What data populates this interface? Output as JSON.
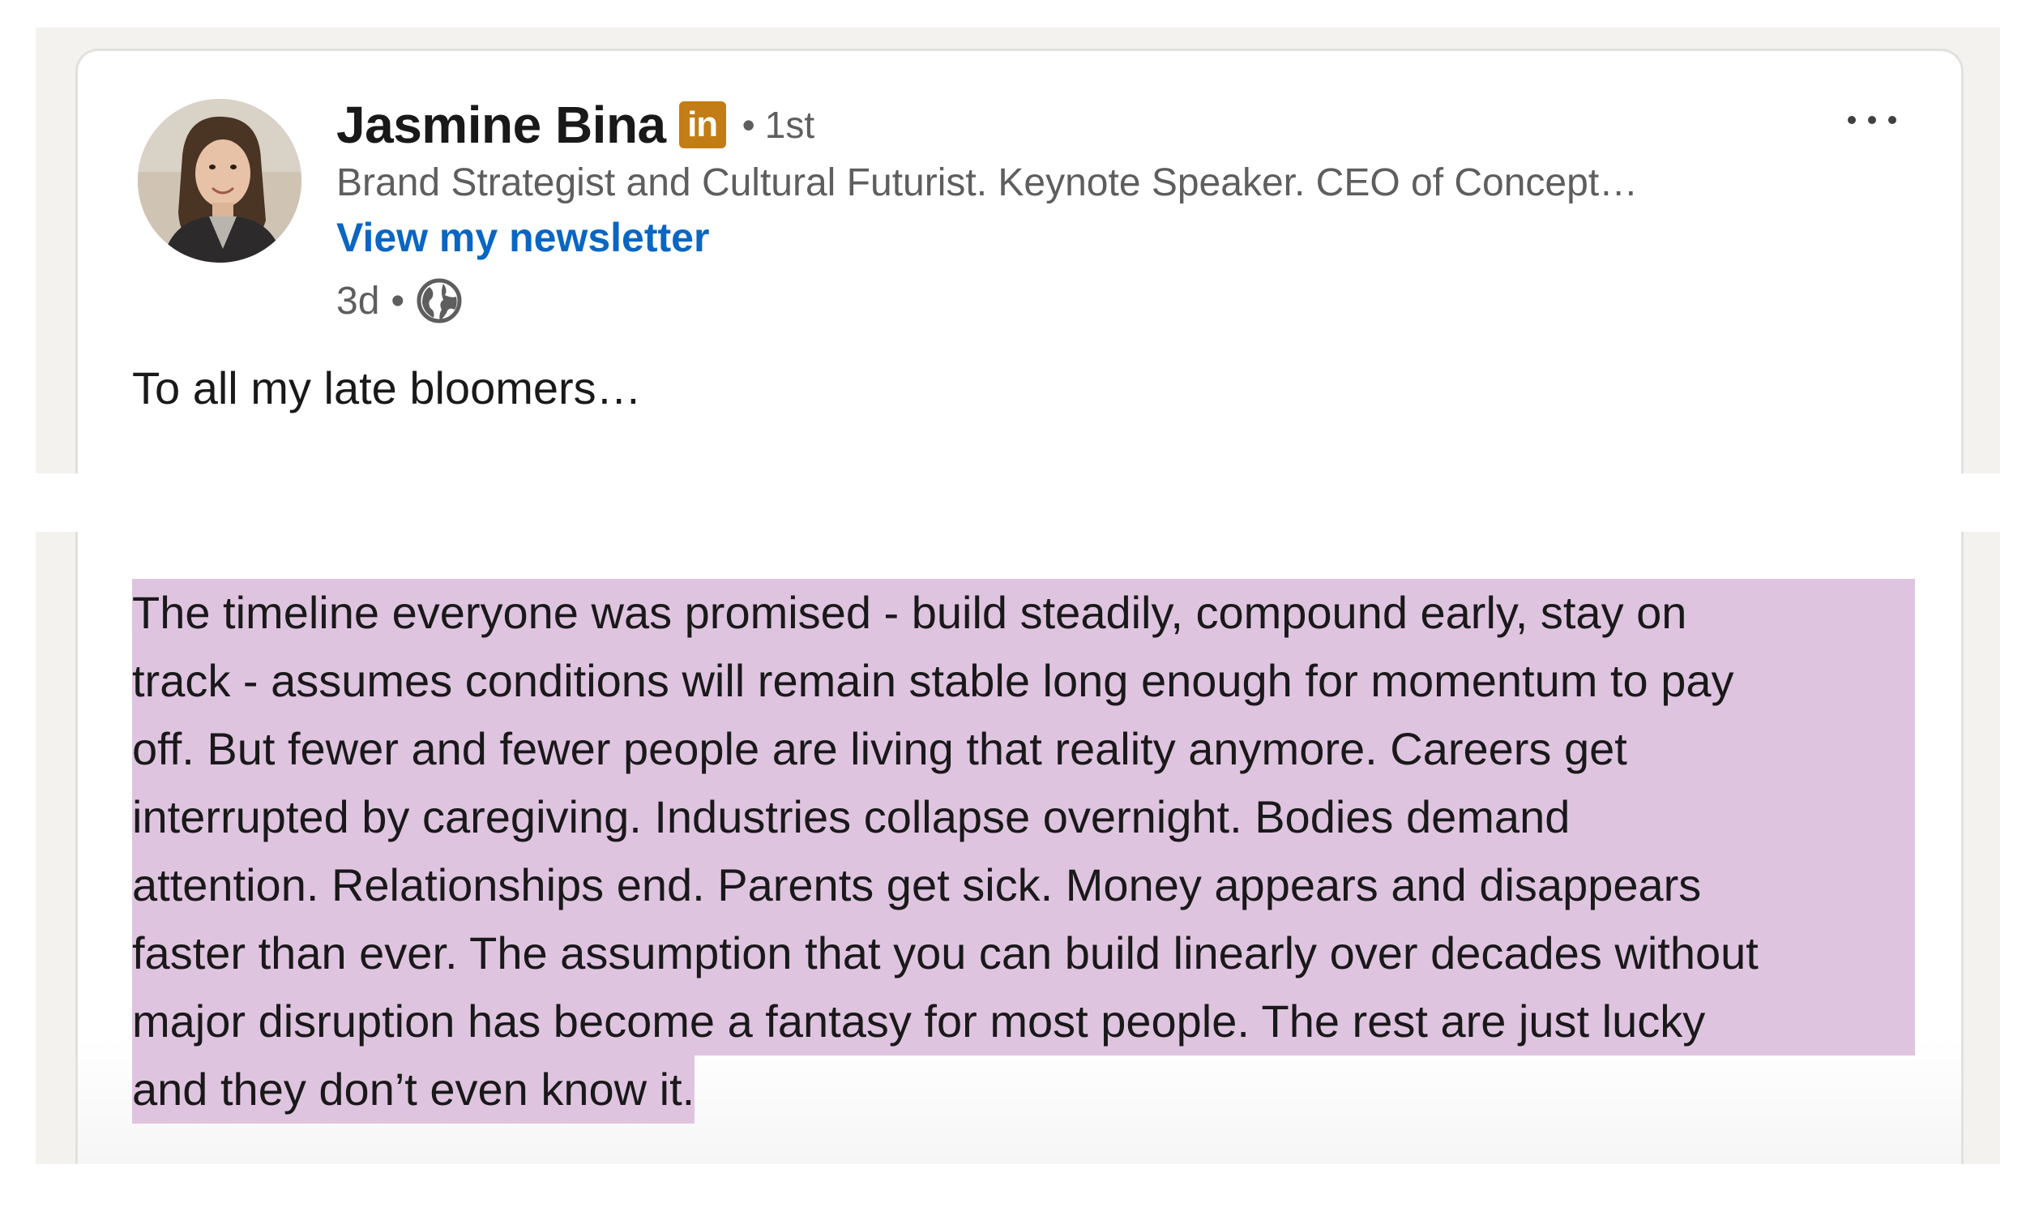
{
  "post": {
    "author": {
      "name": "Jasmine Bina",
      "badge_text": "in",
      "degree": "1st",
      "degree_separator": "•",
      "headline": "Brand Strategist and Cultural Futurist. Keynote Speaker. CEO of Concept…",
      "newsletter_link": "View my newsletter",
      "time_ago": "3d",
      "time_separator": "•",
      "visibility_icon": "globe-icon"
    },
    "more_icon": "more-horizontal-icon",
    "intro_text": "To all my late bloomers…",
    "body_lines": [
      "The timeline everyone was promised - build steadily, compound early, stay on",
      "track - assumes conditions will remain stable long enough for momentum to pay",
      "off. But fewer and fewer people are living that reality anymore. Careers get",
      "interrupted by caregiving. Industries collapse overnight. Bodies demand",
      "attention. Relationships end. Parents get sick. Money appears and disappears",
      "faster than ever. The assumption that you can build linearly over decades without",
      "major disruption has become a fantasy for most people. The rest are just lucky",
      "and they don’t even know it."
    ]
  },
  "colors": {
    "highlight": "#dfc4e0",
    "link": "#0a66c2",
    "badge": "#c37d16",
    "frame": "#f3f2ef"
  }
}
